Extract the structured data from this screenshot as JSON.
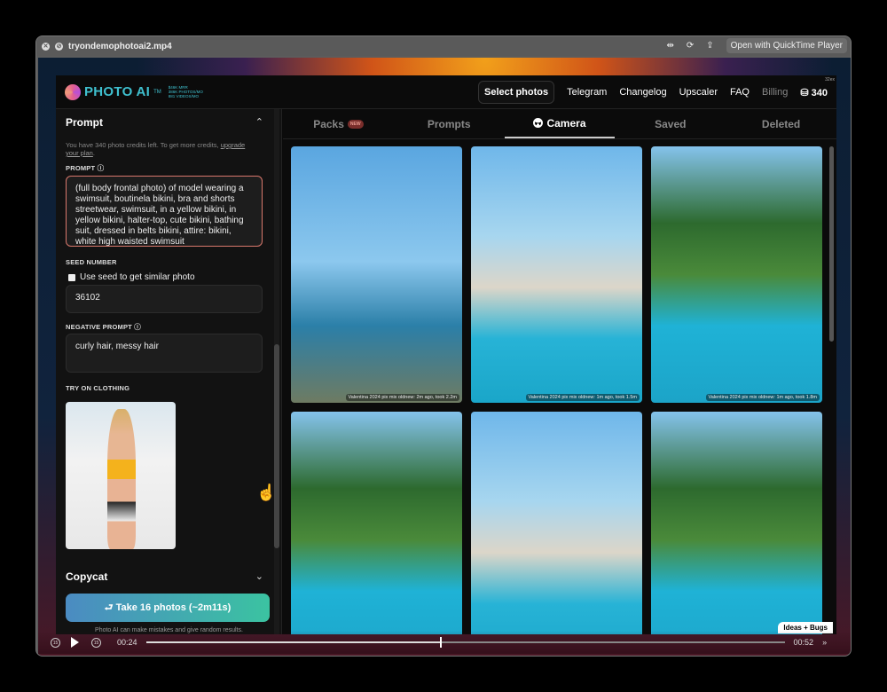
{
  "window": {
    "title": "tryondemophotoai2.mp4",
    "open_with": "Open with QuickTime Player"
  },
  "app": {
    "logo": {
      "name": "PHOTO AI",
      "tm": "TM",
      "stats": [
        "$46K MRR",
        "386K PHOTOS/MO",
        "881 VIDEOS/MO"
      ]
    },
    "nav": {
      "select_photos": "Select photos",
      "items": [
        "Telegram",
        "Changelog",
        "Upscaler",
        "FAQ"
      ],
      "billing": "Billing",
      "credits": "340",
      "corner_tag": "32ex"
    },
    "left": {
      "prompt_section": "Prompt",
      "credits_text": "You have 340 photo credits left. To get more credits,",
      "upgrade_link": "upgrade your plan",
      "prompt_label": "PROMPT",
      "prompt_value": "(full body frontal photo) of model wearing a swimsuit, boutinela bikini, bra and shorts streetwear, swimsuit, in a yellow bikini, in yellow bikini, halter-top, cute bikini, bathing suit, dressed in belts bikini, attire: bikini, white high waisted swimsuit",
      "seed_label": "SEED NUMBER",
      "seed_checkbox": "Use seed to get similar photo",
      "seed_checked": false,
      "seed_value": "36102",
      "negative_label": "NEGATIVE PROMPT",
      "negative_value": "curly hair, messy hair",
      "tryon_label": "TRY ON CLOTHING",
      "copycat_section": "Copycat",
      "take_button": "⮐ Take 16 photos (~2m11s)",
      "disclaimer": "Photo AI can make mistakes and give random results."
    },
    "tabs": [
      {
        "label": "Packs",
        "badge": "NEW"
      },
      {
        "label": "Prompts"
      },
      {
        "label": "Camera",
        "active": true
      },
      {
        "label": "Saved"
      },
      {
        "label": "Deleted"
      }
    ],
    "photos": [
      {
        "caption": "Valentina 2024 pix mix oldnew: 2m ago, took 2.2m",
        "bg": "sky"
      },
      {
        "caption": "Valentina 2024 pix mix oldnew: 1m ago, took 1.5m",
        "bg": "pool"
      },
      {
        "caption": "Valentina 2024 pix mix oldnew: 1m ago, took 1.8m",
        "bg": "palm"
      },
      {
        "caption": "",
        "bg": "palm"
      },
      {
        "caption": "",
        "bg": "pool"
      },
      {
        "caption": "",
        "bg": "palm"
      }
    ],
    "ideas_badge": "Ideas + Bugs"
  },
  "player": {
    "current": "00:24",
    "duration": "00:52",
    "progress": 0.46,
    "skip_back": "15",
    "skip_fwd": "15"
  }
}
